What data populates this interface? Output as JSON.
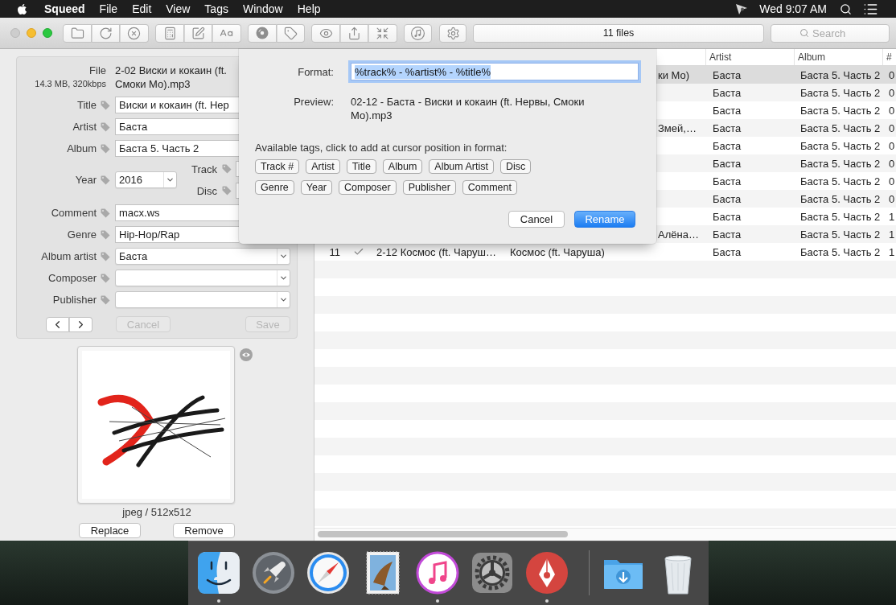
{
  "menu_bar": {
    "app_name": "Squeed",
    "menus": [
      "File",
      "Edit",
      "View",
      "Tags",
      "Window",
      "Help"
    ],
    "clock": "Wed 9:07 AM"
  },
  "toolbar": {
    "status": "11 files",
    "search_placeholder": "Search"
  },
  "editor": {
    "file": {
      "label": "File",
      "info": "14.3 MB, 320kbps",
      "name_lines": [
        "2-02 Виски и кокаин (ft.",
        "Смоки Мо).mp3"
      ]
    },
    "fields": [
      {
        "kind": "text",
        "label": "Title",
        "value": "Виски и кокаин (ft. Нер"
      },
      {
        "kind": "text",
        "label": "Artist",
        "value": "Баста"
      },
      {
        "kind": "text",
        "label": "Album",
        "value": "Баста 5. Часть 2"
      },
      {
        "kind": "numbers",
        "label": "Year",
        "value": "2016",
        "side_fields": [
          {
            "label": "Track"
          },
          {
            "label": "Disc"
          }
        ]
      },
      {
        "kind": "text",
        "label": "Comment",
        "value": "macx.ws"
      },
      {
        "kind": "text",
        "label": "Genre",
        "value": "Hip-Hop/Rap"
      },
      {
        "kind": "combo",
        "label": "Album artist",
        "value": "Баста"
      },
      {
        "kind": "combo",
        "label": "Composer"
      },
      {
        "kind": "combo",
        "label": "Publisher"
      }
    ],
    "buttons": [
      {
        "label": "Cancel",
        "disabled": true
      },
      {
        "label": "Save",
        "disabled": true
      }
    ]
  },
  "artwork": {
    "caption": "jpeg / 512x512",
    "buttons": [
      "Replace",
      "Remove"
    ]
  },
  "rename_popover": {
    "format_label": "Format:",
    "format_value": "%track% - %artist% - %title%",
    "format_selected": true,
    "preview_label": "Preview:",
    "preview_value": "02-12 - Баста - Виски и кокаин (ft. Нервы, Смоки Мо).mp3",
    "tags_hint": "Available tags, click to add at cursor position in format:",
    "tag_rows": [
      [
        "Track #",
        "Artist",
        "Title",
        "Album",
        "Album Artist",
        "Disc"
      ],
      [
        "Genre",
        "Year",
        "Composer",
        "Publisher",
        "Comment"
      ]
    ],
    "buttons": [
      {
        "label": "Cancel",
        "kind": "normal"
      },
      {
        "label": "Rename",
        "kind": "default"
      }
    ]
  },
  "table": {
    "columns": [
      "Artist",
      "Album",
      "#"
    ],
    "rows": [
      {
        "selected": true,
        "column_4": "ки Мо)",
        "artist": "Баста",
        "album": "Баста 5. Часть 2",
        "number": "0"
      },
      {
        "selected": false,
        "artist": "Баста",
        "album": "Баста 5. Часть 2",
        "number": "0"
      },
      {
        "selected": false,
        "artist": "Баста",
        "album": "Баста 5. Часть 2",
        "number": "0"
      },
      {
        "selected": false,
        "column_4": "Змей,…",
        "artist": "Баста",
        "album": "Баста 5. Часть 2",
        "number": "0"
      },
      {
        "selected": false,
        "artist": "Баста",
        "album": "Баста 5. Часть 2",
        "number": "0"
      },
      {
        "selected": false,
        "artist": "Баста",
        "album": "Баста 5. Часть 2",
        "number": "0"
      },
      {
        "selected": false,
        "artist": "Баста",
        "album": "Баста 5. Часть 2",
        "number": "0"
      },
      {
        "selected": false,
        "artist": "Баста",
        "album": "Баста 5. Часть 2",
        "number": "0"
      },
      {
        "selected": false,
        "artist": "Баста",
        "album": "Баста 5. Часть 2",
        "number": "1"
      },
      {
        "selected": false,
        "column_4": "Алёна…",
        "artist": "Баста",
        "album": "Баста 5. Часть 2",
        "number": "1"
      },
      {
        "selected": false,
        "column_1": "11",
        "checked": true,
        "column_3": "2-12 Космос (ft. Чаруш…",
        "column_4": "Космос (ft. Чаруша)",
        "artist": "Баста",
        "album": "Баста 5. Часть 2",
        "number": "1"
      }
    ]
  },
  "dock": {
    "apps": [
      {
        "kind": "face",
        "running": true
      },
      {
        "kind": "rocket",
        "running": false
      },
      {
        "kind": "compass",
        "running": false
      },
      {
        "kind": "stamp",
        "running": false
      },
      {
        "kind": "music",
        "running": true
      },
      {
        "kind": "gear",
        "running": false
      },
      {
        "kind": "nib",
        "running": true
      }
    ],
    "stacks": [
      {
        "kind": "folder"
      },
      {
        "kind": "trash"
      }
    ]
  }
}
